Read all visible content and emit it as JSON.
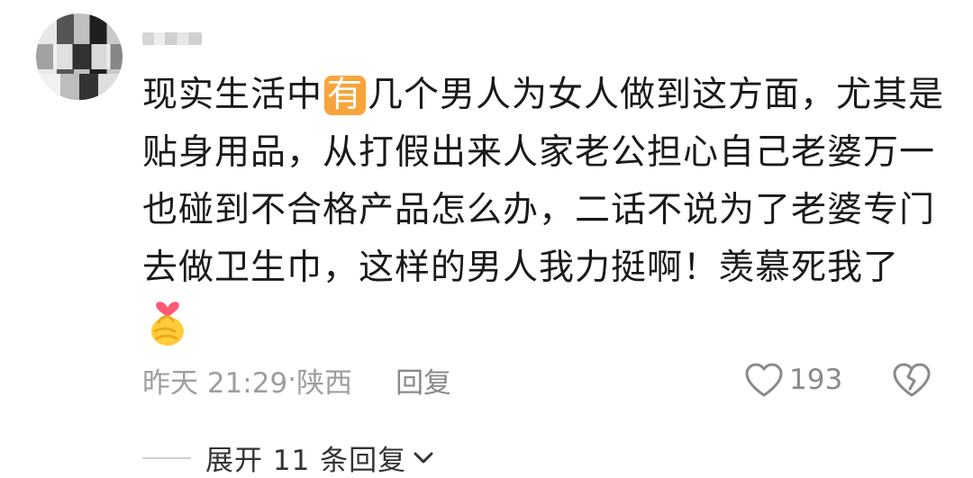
{
  "comment": {
    "username": "",
    "body_lines": [
      {
        "before": "现实生活中",
        "badge": "有",
        "after": "几个男人为女人做到这方面，尤其是"
      },
      {
        "text": "贴身用品，从打假出来人家老公担心自己老婆万一"
      },
      {
        "text": "也碰到不合格产品怎么办，二话不说为了老婆专门"
      },
      {
        "text": "去做卫生巾，这样的男人我力挺啊！羡慕死我了"
      }
    ],
    "emoji": "finger-heart-emoji",
    "meta": {
      "time": "昨天 21:29",
      "separator": "·",
      "location": "陕西",
      "reply_label": "回复"
    },
    "likes": {
      "icon": "heart-outline-icon",
      "count": "193"
    },
    "dislike_icon": "broken-heart-icon",
    "expand_label": "展开 11 条回复",
    "colors": {
      "badge_bg": "#f7a53b",
      "meta_text": "#9e9e9e",
      "body_text": "#1a1a1a"
    }
  }
}
